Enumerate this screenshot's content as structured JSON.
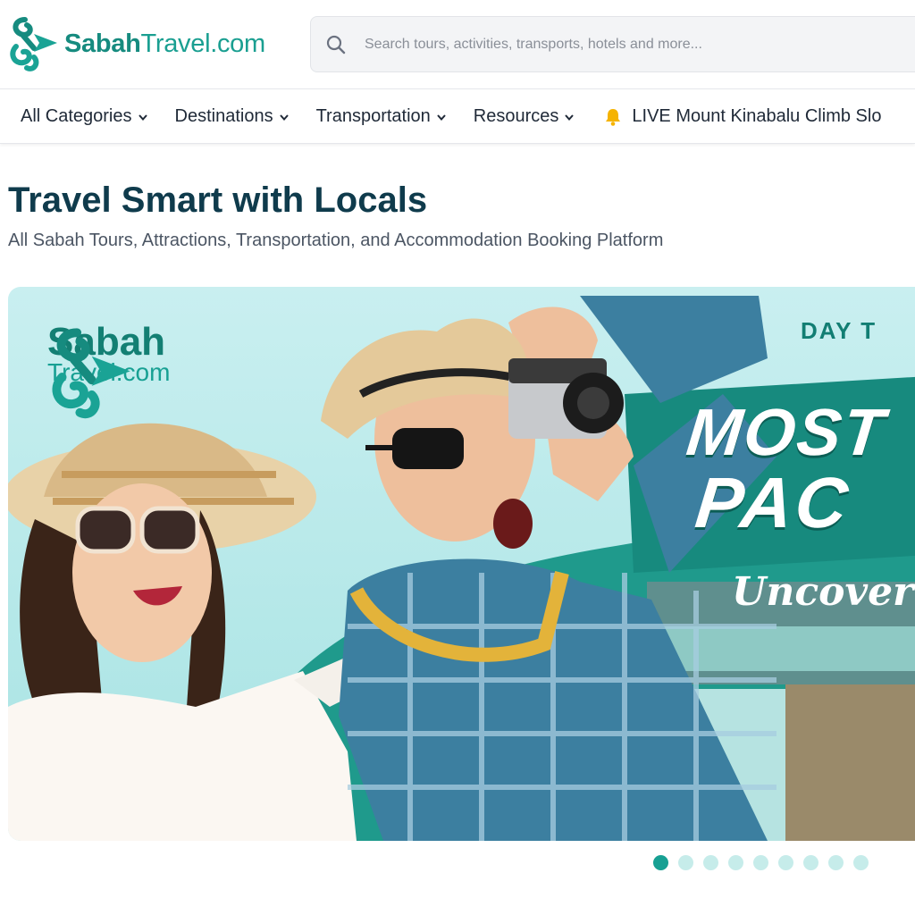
{
  "header": {
    "logo": {
      "strong": "Sabah",
      "light": "Travel.com"
    },
    "search": {
      "placeholder": "Search tours, activities, transports, hotels and more..."
    }
  },
  "nav": {
    "items": [
      {
        "label": "All Categories",
        "icon": "chevron-down-icon"
      },
      {
        "label": "Destinations",
        "icon": "chevron-down-icon"
      },
      {
        "label": "Transportation",
        "icon": "chevron-down-icon"
      },
      {
        "label": "Resources",
        "icon": "chevron-down-icon"
      }
    ],
    "live": {
      "label": "LIVE Mount Kinabalu Climb Slo",
      "icon": "bell-icon"
    }
  },
  "hero": {
    "title": "Travel Smart with Locals",
    "subtitle": "All Sabah Tours, Attractions, Transportation, and Accommodation Booking Platform"
  },
  "banner": {
    "brand": {
      "line1": "Sabah",
      "line2": "Travel.com"
    },
    "promo_top": "DAY T",
    "promo_big_1": "MOST",
    "promo_big_2": "PAC",
    "promo_script": "Uncover S"
  },
  "carousel": {
    "total": 9,
    "active": 0
  },
  "colors": {
    "brand": "#168b7f",
    "brand_light": "#1a9f91",
    "title": "#0f3b4c",
    "dot_active": "#17a093",
    "dot_inactive": "#c6ecea",
    "banner_bg": "#c9eff0"
  }
}
